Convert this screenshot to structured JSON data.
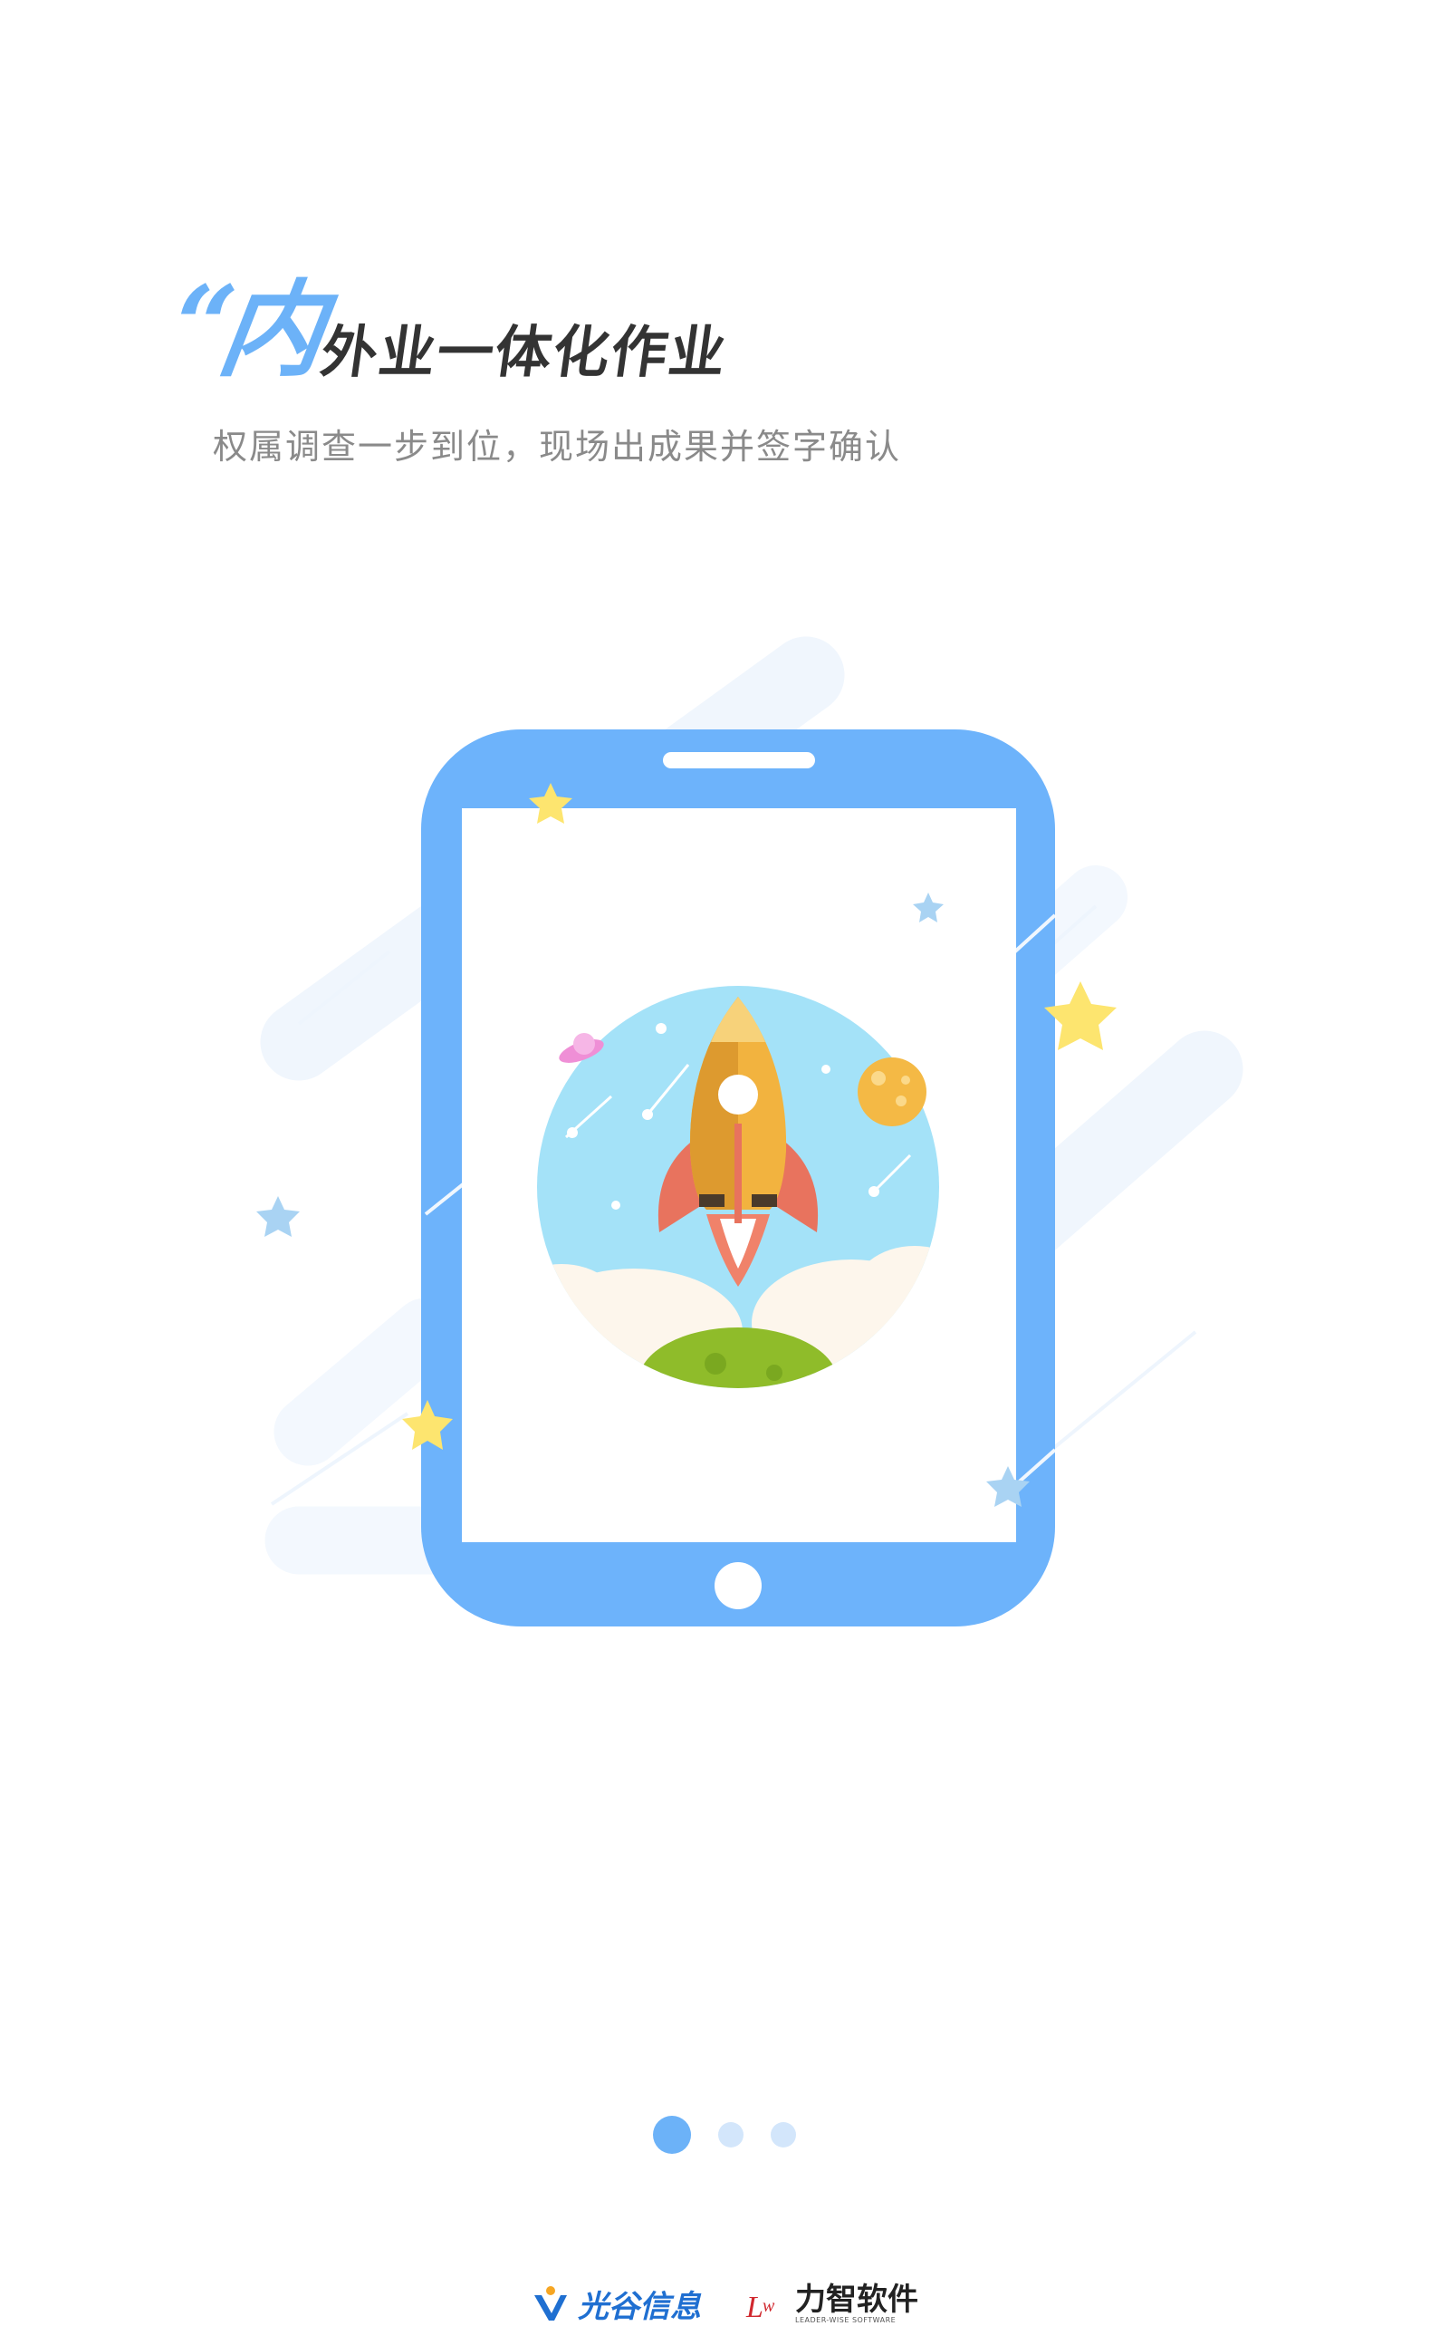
{
  "headline": {
    "quote": "“",
    "first_char": "内",
    "rest": "外业一体化作业"
  },
  "subtitle": "权属调查一步到位，现场出成果并签字确认",
  "pagination": {
    "count": 3,
    "active_index": 0
  },
  "footer": {
    "brand1": "光谷信息",
    "brand2": "力智软件",
    "brand2_sub": "LEADER-WISE SOFTWARE"
  },
  "colors": {
    "accent": "#6cb2f8",
    "tablet_body": "#6db3fb",
    "star_yellow": "#fde56f",
    "star_blue": "#a9d3f3"
  }
}
